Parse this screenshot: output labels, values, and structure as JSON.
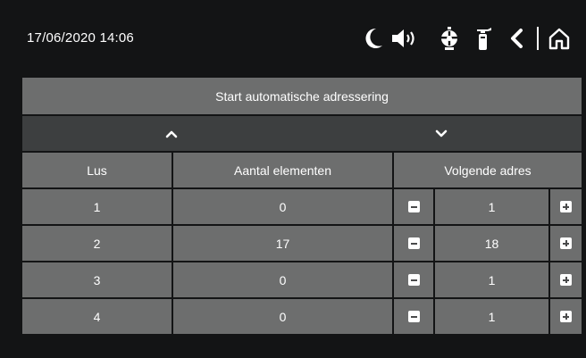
{
  "status": {
    "datetime": "17/06/2020  14:06",
    "icons": [
      "moon-icon",
      "speaker-icon",
      "alarm-bell-icon",
      "extinguisher-icon",
      "back-icon",
      "home-icon"
    ]
  },
  "actions": {
    "start_label": "Start automatische adressering"
  },
  "table": {
    "headers": {
      "loop": "Lus",
      "count": "Aantal elementen",
      "next": "Volgende adres"
    },
    "rows": [
      {
        "loop": "1",
        "count": "0",
        "next": "1"
      },
      {
        "loop": "2",
        "count": "17",
        "next": "18"
      },
      {
        "loop": "3",
        "count": "0",
        "next": "1"
      },
      {
        "loop": "4",
        "count": "0",
        "next": "1"
      }
    ]
  },
  "colors": {
    "background": "#131415",
    "cell": "#6d6e6e",
    "dark_cell": "#3d3f40",
    "text": "#ffffff"
  }
}
